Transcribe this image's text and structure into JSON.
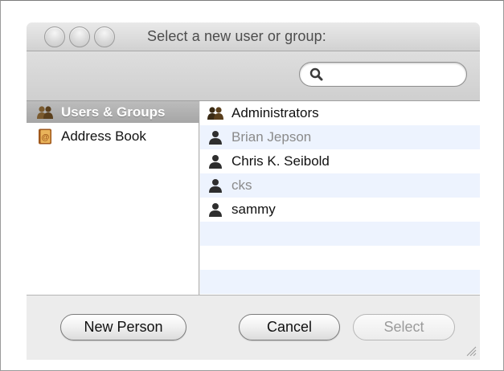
{
  "dialog": {
    "title": "Select a new user or group:"
  },
  "search": {
    "value": "",
    "placeholder": ""
  },
  "sidebar": {
    "items": [
      {
        "label": "Users & Groups",
        "icon": "users-group-icon",
        "selected": true
      },
      {
        "label": "Address Book",
        "icon": "address-book-icon",
        "selected": false
      }
    ]
  },
  "users": {
    "rows": [
      {
        "label": "Administrators",
        "icon": "group-icon",
        "dimmed": false
      },
      {
        "label": "Brian Jepson",
        "icon": "person-icon",
        "dimmed": true
      },
      {
        "label": "Chris K. Seibold",
        "icon": "person-icon",
        "dimmed": false
      },
      {
        "label": "cks",
        "icon": "person-icon",
        "dimmed": true
      },
      {
        "label": "sammy",
        "icon": "person-icon",
        "dimmed": false
      }
    ]
  },
  "buttons": {
    "new_person": "New Person",
    "cancel": "Cancel",
    "select": "Select"
  },
  "colors": {
    "list_alt_row": "#edf3fe",
    "sidebar_selected": "#a6a6a6",
    "window_bg": "#ececec"
  }
}
